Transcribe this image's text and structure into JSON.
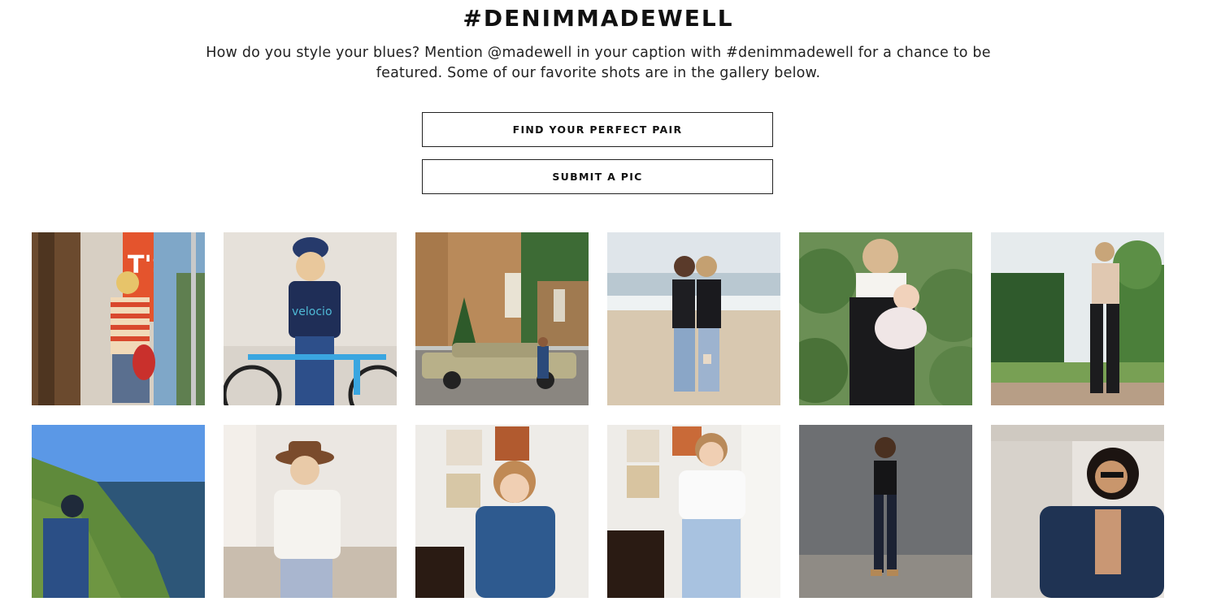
{
  "heading": "#DENIMMADEWELL",
  "intro": "How do you style your blues? Mention @madewell in your caption with #denimmadewell for a chance to be featured. Some of our favorite shots are in the gallery below.",
  "buttons": {
    "find_pair": "FIND YOUR PERFECT PAIR",
    "submit_pic": "SUBMIT A PIC"
  },
  "gallery": {
    "photos": [
      {
        "subject": "woman in striped tee by storefront",
        "sign_text": "T'S"
      },
      {
        "subject": "woman in navy velocio tee with bicycle",
        "shirt_text": "velocio"
      },
      {
        "subject": "woman by vintage car and brick building"
      },
      {
        "subject": "two women on beach"
      },
      {
        "subject": "woman in overalls holding baby"
      },
      {
        "subject": "woman in garden wearing black jeans"
      },
      {
        "subject": "person on coastal cliff"
      },
      {
        "subject": "woman in hat and white blouse"
      },
      {
        "subject": "woman in denim jumpsuit"
      },
      {
        "subject": "woman in ruffle top and light jeans"
      },
      {
        "subject": "woman in black tank and dark jeans against gray wall"
      },
      {
        "subject": "woman in sunglasses and denim jacket"
      }
    ]
  }
}
